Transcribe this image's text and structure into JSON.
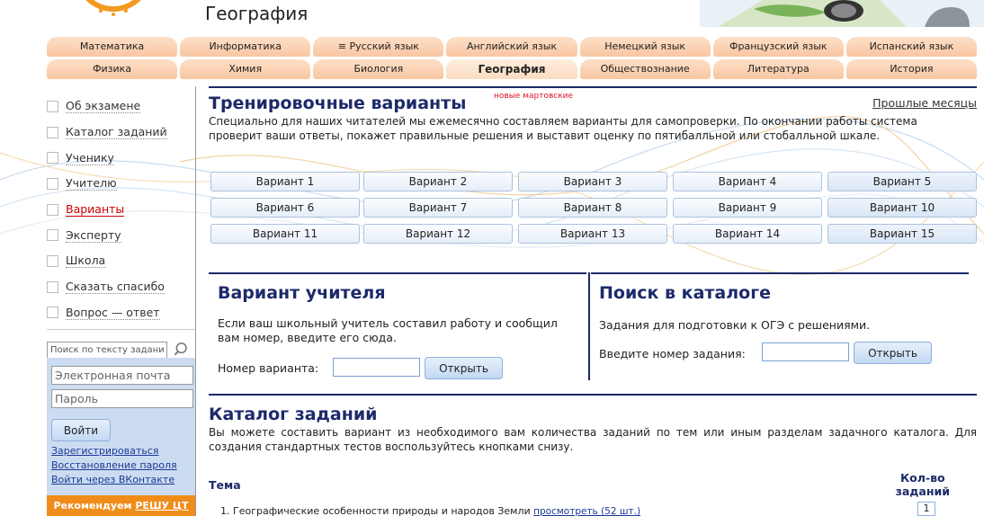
{
  "header": {
    "subject_title": "География"
  },
  "tabs": {
    "row1": [
      {
        "label": "Математика"
      },
      {
        "label": "Информатика"
      },
      {
        "label": "≡ Русский язык"
      },
      {
        "label": "Английский язык"
      },
      {
        "label": "Немецкий язык"
      },
      {
        "label": "Французский язык"
      },
      {
        "label": "Испанский язык"
      }
    ],
    "row2": [
      {
        "label": "Физика"
      },
      {
        "label": "Химия"
      },
      {
        "label": "Биология"
      },
      {
        "label": "География",
        "active": true
      },
      {
        "label": "Обществознание"
      },
      {
        "label": "Литература"
      },
      {
        "label": "История"
      }
    ]
  },
  "sidebar": {
    "items": [
      {
        "label": "Об экзамене"
      },
      {
        "label": "Каталог заданий"
      },
      {
        "label": "Ученику"
      },
      {
        "label": "Учителю"
      },
      {
        "label": "Варианты",
        "active": true
      },
      {
        "label": "Эксперту"
      },
      {
        "label": "Школа"
      },
      {
        "label": "Сказать спасибо"
      },
      {
        "label": "Вопрос — ответ"
      }
    ],
    "search_placeholder": "Поиск по тексту задания"
  },
  "login": {
    "email_placeholder": "Электронная почта",
    "password_placeholder": "Пароль",
    "login_button": "Войти",
    "register_link": "Зарегистрироваться",
    "restore_link": "Восстановление пароля",
    "vk_link": "Войти через ВКонтакте",
    "recommend_text": "Рекомендуем ",
    "recommend_link": "РЕШУ ЦТ"
  },
  "training": {
    "title": "Тренировочные варианты",
    "badge": "новые мартовские",
    "past_months": "Прошлые месяцы",
    "description": "Специально для наших читателей мы ежемесячно составляем варианты для самопроверки. По окончании работы система проверит ваши ответы, покажет правильные решения и выставит оценку по пятибалльной или стобалльной шкале.",
    "variants": [
      "Вариант 1",
      "Вариант 2",
      "Вариант 3",
      "Вариант 4",
      "Вариант 5",
      "Вариант 6",
      "Вариант 7",
      "Вариант 8",
      "Вариант 9",
      "Вариант 10",
      "Вариант 11",
      "Вариант 12",
      "Вариант 13",
      "Вариант 14",
      "Вариант 15"
    ]
  },
  "teacher_variant": {
    "title": "Вариант учителя",
    "description": "Если ваш школьный учитель составил работу и сообщил вам номер, введите его сюда.",
    "number_label": "Номер варианта:",
    "open_button": "Открыть"
  },
  "catalog_search": {
    "title": "Поиск в каталоге",
    "description": "Задания для подготовки к ОГЭ с решениями.",
    "number_label": "Введите номер задания:",
    "open_button": "Открыть"
  },
  "catalog": {
    "title": "Каталог заданий",
    "description": "Вы можете составить вариант из необходимого вам количества заданий по тем или иным разделам задачного каталога. Для создания стандартных тестов воспользуйтесь кнопками снизу.",
    "theme_header": "Тема",
    "count_header_line1": "Кол-во",
    "count_header_line2": "заданий",
    "topics": [
      {
        "title": "1. Географические особенности природы и народов Земли ",
        "link": "просмотреть (52 шт.)",
        "count": "1"
      }
    ]
  }
}
